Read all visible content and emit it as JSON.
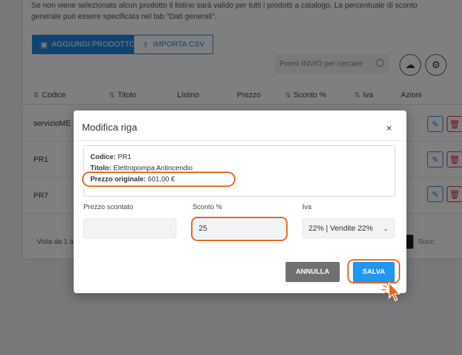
{
  "background": {
    "info_text": "Se non viene selezionato alcun prodotto il listino sarà valido per tutti i prodotti a catalogo. La percentuale di sconto generale può essere specificata nel tab \"Dati generali\".",
    "add_product_label": "AGGIUNGI PRODOTTO",
    "import_csv_label": "IMPORTA CSV",
    "search_placeholder": "Premi INVIO per cercare",
    "columns": [
      "Codice",
      "Titolo",
      "Listino",
      "Prezzo",
      "Sconto %",
      "Iva",
      "Azioni"
    ],
    "rows": [
      {
        "code": "servizioME"
      },
      {
        "code": "PR1"
      },
      {
        "code": "PR7"
      }
    ],
    "pager_text": "Vista da 1 a",
    "pager_next": "Succ."
  },
  "modal": {
    "title": "Modifica riga",
    "close_icon": "×",
    "info": {
      "code_label": "Codice:",
      "code_value": "PR1",
      "title_label": "Titolo:",
      "title_value": "Elettropompa Antincendio",
      "price_label": "Prezzo originale:",
      "price_value": "601,00 €"
    },
    "fields": {
      "discounted_price_label": "Prezzo scontato",
      "discounted_price_value": "",
      "discount_label": "Sconto %",
      "discount_value": "25",
      "vat_label": "Iva",
      "vat_value": "22% | Vendite 22%"
    },
    "cancel_label": "ANNULLA",
    "save_label": "SALVA"
  },
  "colors": {
    "primary": "#2196f3",
    "highlight": "#e8671a",
    "cancel": "#707070",
    "danger": "#d32f2f"
  }
}
